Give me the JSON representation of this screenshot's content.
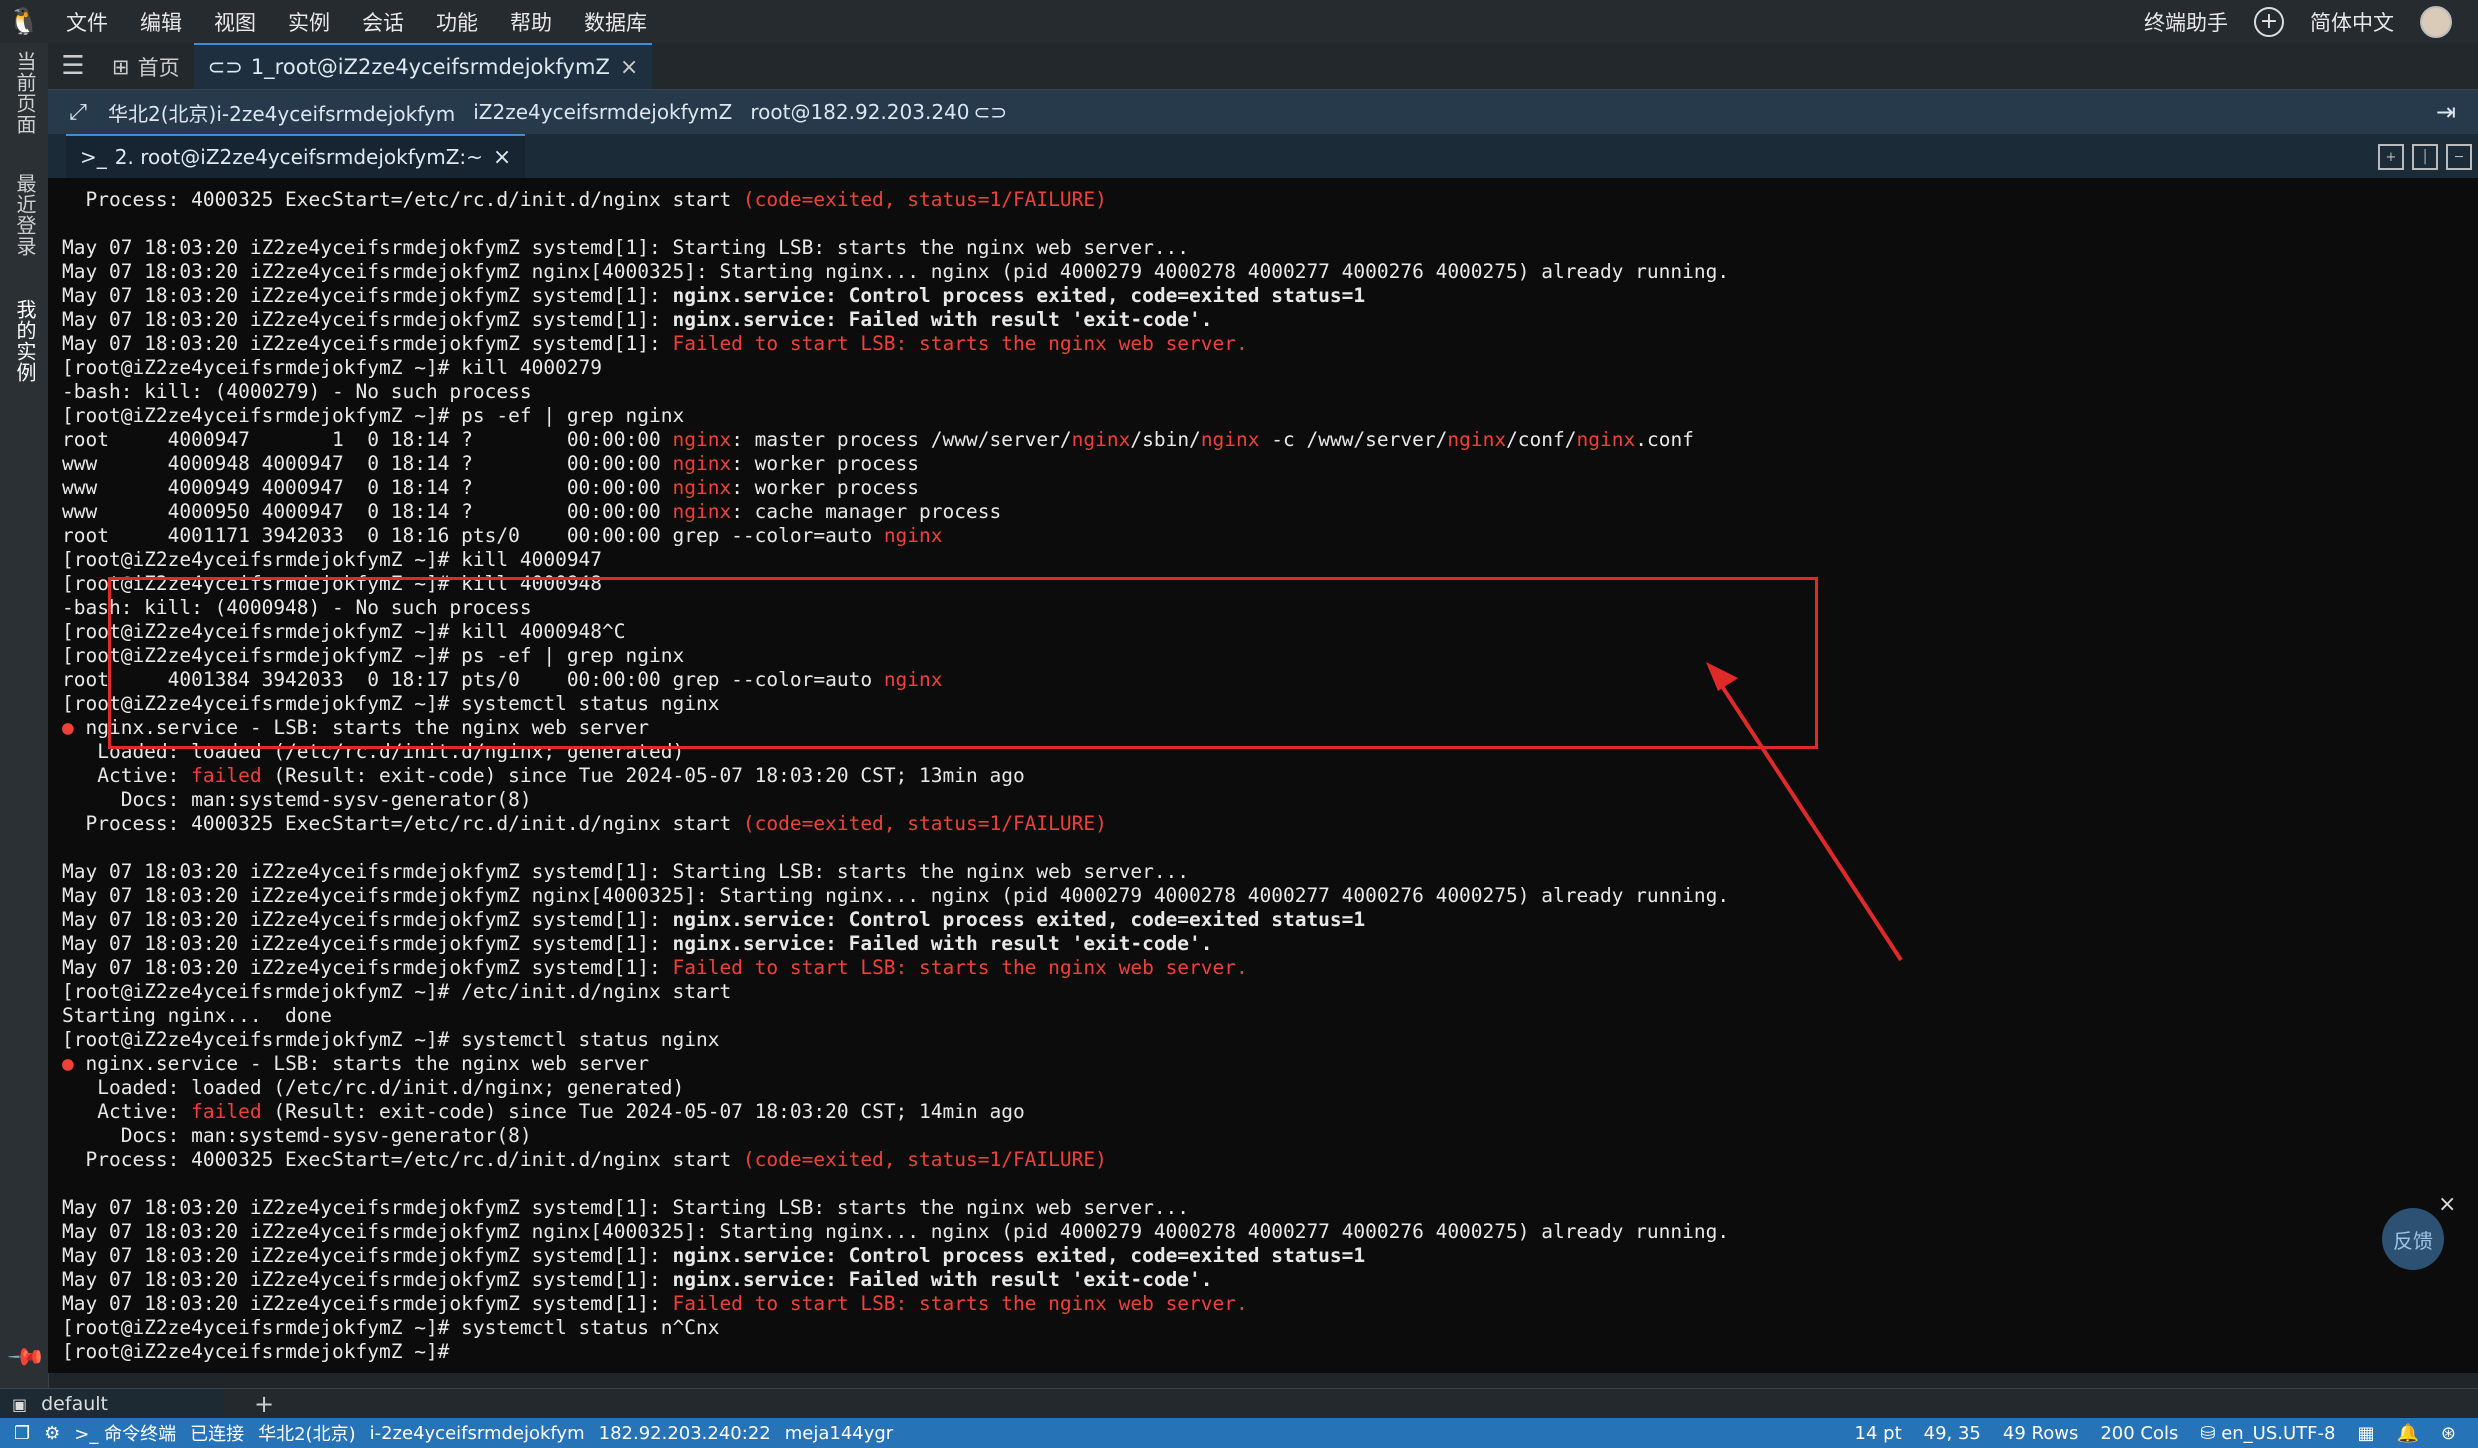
{
  "menubar": {
    "items": [
      "文件",
      "编辑",
      "视图",
      "实例",
      "会话",
      "功能",
      "帮助",
      "数据库"
    ],
    "terminal_assistant": "终端助手",
    "language": "简体中文"
  },
  "sidebar": {
    "tabs": [
      "当前页面",
      "最近登录",
      "我的实例"
    ]
  },
  "tabbar": {
    "home_label": "首页",
    "session_tab_label": "1_root@iZ2ze4yceifsrmdejokfymZ"
  },
  "infobar": {
    "region_instance": "华北2(北京)i-2ze4yceifsrmdejokfym",
    "hostname": "iZ2ze4yceifsrmdejokfymZ",
    "user_host": "root@182.92.203.240"
  },
  "subtab": {
    "label": "2. root@iZ2ze4yceifsrmdejokfymZ:~"
  },
  "terminal": {
    "lines": [
      [
        {
          "t": "  Process: 4000325 ExecStart=/etc/rc.d/init.d/nginx start "
        },
        {
          "t": "(code=exited, status=1/FAILURE)",
          "c": "red"
        }
      ],
      [
        {
          "t": ""
        }
      ],
      [
        {
          "t": "May 07 18:03:20 iZ2ze4yceifsrmdejokfymZ systemd[1]: Starting LSB: starts the nginx web server..."
        }
      ],
      [
        {
          "t": "May 07 18:03:20 iZ2ze4yceifsrmdejokfymZ nginx[4000325]: Starting nginx... nginx (pid 4000279 4000278 4000277 4000276 4000275) already running."
        }
      ],
      [
        {
          "t": "May 07 18:03:20 iZ2ze4yceifsrmdejokfymZ systemd[1]: "
        },
        {
          "t": "nginx.service: Control process exited, code=exited status=1",
          "c": "b"
        }
      ],
      [
        {
          "t": "May 07 18:03:20 iZ2ze4yceifsrmdejokfymZ systemd[1]: "
        },
        {
          "t": "nginx.service: Failed with result 'exit-code'.",
          "c": "b"
        }
      ],
      [
        {
          "t": "May 07 18:03:20 iZ2ze4yceifsrmdejokfymZ systemd[1]: "
        },
        {
          "t": "Failed to start LSB: starts the nginx web server.",
          "c": "red"
        }
      ],
      [
        {
          "t": "[root@iZ2ze4yceifsrmdejokfymZ ~]# kill 4000279"
        }
      ],
      [
        {
          "t": "-bash: kill: (4000279) - No such process"
        }
      ],
      [
        {
          "t": "[root@iZ2ze4yceifsrmdejokfymZ ~]# ps -ef | grep nginx"
        }
      ],
      [
        {
          "t": "root     4000947       1  0 18:14 ?        00:00:00 "
        },
        {
          "t": "nginx",
          "c": "red"
        },
        {
          "t": ": master process /www/server/"
        },
        {
          "t": "nginx",
          "c": "red"
        },
        {
          "t": "/sbin/"
        },
        {
          "t": "nginx",
          "c": "red"
        },
        {
          "t": " -c /www/server/"
        },
        {
          "t": "nginx",
          "c": "red"
        },
        {
          "t": "/conf/"
        },
        {
          "t": "nginx",
          "c": "red"
        },
        {
          "t": ".conf"
        }
      ],
      [
        {
          "t": "www      4000948 4000947  0 18:14 ?        00:00:00 "
        },
        {
          "t": "nginx",
          "c": "red"
        },
        {
          "t": ": worker process"
        }
      ],
      [
        {
          "t": "www      4000949 4000947  0 18:14 ?        00:00:00 "
        },
        {
          "t": "nginx",
          "c": "red"
        },
        {
          "t": ": worker process"
        }
      ],
      [
        {
          "t": "www      4000950 4000947  0 18:14 ?        00:00:00 "
        },
        {
          "t": "nginx",
          "c": "red"
        },
        {
          "t": ": cache manager process"
        }
      ],
      [
        {
          "t": "root     4001171 3942033  0 18:16 pts/0    00:00:00 grep --color=auto "
        },
        {
          "t": "nginx",
          "c": "red"
        }
      ],
      [
        {
          "t": "[root@iZ2ze4yceifsrmdejokfymZ ~]# kill 4000947"
        }
      ],
      [
        {
          "t": "[root@iZ2ze4yceifsrmdejokfymZ ~]# kill 4000948"
        }
      ],
      [
        {
          "t": "-bash: kill: (4000948) - No such process"
        }
      ],
      [
        {
          "t": "[root@iZ2ze4yceifsrmdejokfymZ ~]# kill 4000948^C"
        }
      ],
      [
        {
          "t": "[root@iZ2ze4yceifsrmdejokfymZ ~]# ps -ef | grep nginx"
        }
      ],
      [
        {
          "t": "root     4001384 3942033  0 18:17 pts/0    00:00:00 grep --color=auto "
        },
        {
          "t": "nginx",
          "c": "red"
        }
      ],
      [
        {
          "t": "[root@iZ2ze4yceifsrmdejokfymZ ~]# systemctl status nginx"
        }
      ],
      [
        {
          "t": "●",
          "c": "red"
        },
        {
          "t": " nginx.service - LSB: starts the nginx web server"
        }
      ],
      [
        {
          "t": "   Loaded: loaded (/etc/rc.d/init.d/nginx; generated)"
        }
      ],
      [
        {
          "t": "   Active: "
        },
        {
          "t": "failed",
          "c": "red"
        },
        {
          "t": " (Result: exit-code) since Tue 2024-05-07 18:03:20 CST; 13min ago"
        }
      ],
      [
        {
          "t": "     Docs: man:systemd-sysv-generator(8)"
        }
      ],
      [
        {
          "t": "  Process: 4000325 ExecStart=/etc/rc.d/init.d/nginx start "
        },
        {
          "t": "(code=exited, status=1/FAILURE)",
          "c": "red"
        }
      ],
      [
        {
          "t": ""
        }
      ],
      [
        {
          "t": "May 07 18:03:20 iZ2ze4yceifsrmdejokfymZ systemd[1]: Starting LSB: starts the nginx web server..."
        }
      ],
      [
        {
          "t": "May 07 18:03:20 iZ2ze4yceifsrmdejokfymZ nginx[4000325]: Starting nginx... nginx (pid 4000279 4000278 4000277 4000276 4000275) already running."
        }
      ],
      [
        {
          "t": "May 07 18:03:20 iZ2ze4yceifsrmdejokfymZ systemd[1]: "
        },
        {
          "t": "nginx.service: Control process exited, code=exited status=1",
          "c": "b"
        }
      ],
      [
        {
          "t": "May 07 18:03:20 iZ2ze4yceifsrmdejokfymZ systemd[1]: "
        },
        {
          "t": "nginx.service: Failed with result 'exit-code'.",
          "c": "b"
        }
      ],
      [
        {
          "t": "May 07 18:03:20 iZ2ze4yceifsrmdejokfymZ systemd[1]: "
        },
        {
          "t": "Failed to start LSB: starts the nginx web server.",
          "c": "red"
        }
      ],
      [
        {
          "t": "[root@iZ2ze4yceifsrmdejokfymZ ~]# /etc/init.d/nginx start"
        }
      ],
      [
        {
          "t": "Starting nginx...  done"
        }
      ],
      [
        {
          "t": "[root@iZ2ze4yceifsrmdejokfymZ ~]# systemctl status nginx"
        }
      ],
      [
        {
          "t": "●",
          "c": "red"
        },
        {
          "t": " nginx.service - LSB: starts the nginx web server"
        }
      ],
      [
        {
          "t": "   Loaded: loaded (/etc/rc.d/init.d/nginx; generated)"
        }
      ],
      [
        {
          "t": "   Active: "
        },
        {
          "t": "failed",
          "c": "red"
        },
        {
          "t": " (Result: exit-code) since Tue 2024-05-07 18:03:20 CST; 14min ago"
        }
      ],
      [
        {
          "t": "     Docs: man:systemd-sysv-generator(8)"
        }
      ],
      [
        {
          "t": "  Process: 4000325 ExecStart=/etc/rc.d/init.d/nginx start "
        },
        {
          "t": "(code=exited, status=1/FAILURE)",
          "c": "red"
        }
      ],
      [
        {
          "t": ""
        }
      ],
      [
        {
          "t": "May 07 18:03:20 iZ2ze4yceifsrmdejokfymZ systemd[1]: Starting LSB: starts the nginx web server..."
        }
      ],
      [
        {
          "t": "May 07 18:03:20 iZ2ze4yceifsrmdejokfymZ nginx[4000325]: Starting nginx... nginx (pid 4000279 4000278 4000277 4000276 4000275) already running."
        }
      ],
      [
        {
          "t": "May 07 18:03:20 iZ2ze4yceifsrmdejokfymZ systemd[1]: "
        },
        {
          "t": "nginx.service: Control process exited, code=exited status=1",
          "c": "b"
        }
      ],
      [
        {
          "t": "May 07 18:03:20 iZ2ze4yceifsrmdejokfymZ systemd[1]: "
        },
        {
          "t": "nginx.service: Failed with result 'exit-code'.",
          "c": "b"
        }
      ],
      [
        {
          "t": "May 07 18:03:20 iZ2ze4yceifsrmdejokfymZ systemd[1]: "
        },
        {
          "t": "Failed to start LSB: starts the nginx web server.",
          "c": "red"
        }
      ],
      [
        {
          "t": "[root@iZ2ze4yceifsrmdejokfymZ ~]# systemctl status n^Cnx"
        }
      ],
      [
        {
          "t": "[root@iZ2ze4yceifsrmdejokfymZ ~]# "
        }
      ]
    ]
  },
  "feedback": {
    "label": "反馈"
  },
  "sessionbar": {
    "tab_label": "default"
  },
  "statusbar": {
    "items": [
      "命令终端",
      "已连接",
      "华北2(北京)",
      "i-2ze4yceifsrmdejokfym",
      "182.92.203.240:22",
      "meja144ygr"
    ],
    "right": {
      "font_size": "14 pt",
      "cursor": "49, 35",
      "rows": "49 Rows",
      "cols": "200 Cols",
      "encoding": "en_US.UTF-8"
    }
  },
  "colors": {
    "error_red": "#f0403a",
    "accent_blue": "#2773b8",
    "annotation_red": "#e02a2a"
  }
}
